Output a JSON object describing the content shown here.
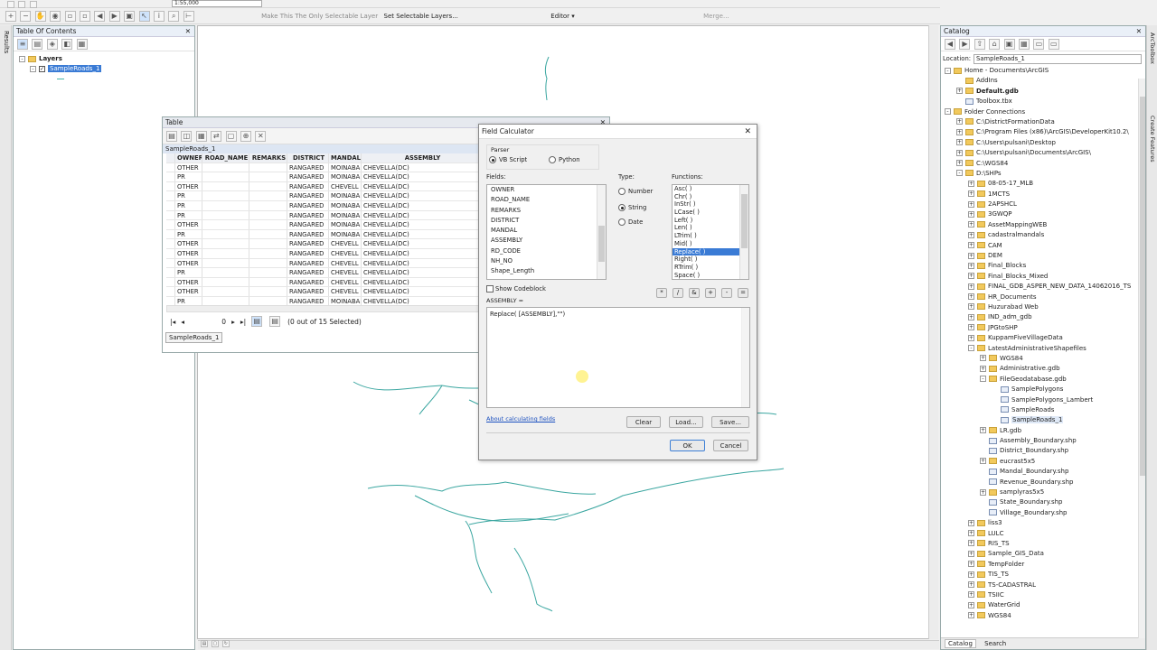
{
  "toolbar": {
    "scale": "1:55,000",
    "selectable_msg": "Make This The Only Selectable Layer",
    "set_selectable": "Set Selectable Layers...",
    "editor": "Editor ▾",
    "merge": "Merge..."
  },
  "toc": {
    "title": "Table Of Contents",
    "side_tab": "Results",
    "layers_label": "Layers",
    "layer_name": "SampleRoads_1"
  },
  "table_win": {
    "title": "Table",
    "tab_name": "SampleRoads_1",
    "columns": [
      "OWNER",
      "ROAD_NAME",
      "REMARKS",
      "DISTRICT",
      "MANDAL",
      "ASSEMBLY"
    ],
    "rows": [
      [
        "OTHER",
        "",
        "",
        "RANGARED",
        "MOINABA",
        "CHEVELLA(DC)"
      ],
      [
        "PR",
        "",
        "",
        "RANGARED",
        "MOINABA",
        "CHEVELLA(DC)"
      ],
      [
        "OTHER",
        "",
        "",
        "RANGARED",
        "CHEVELL",
        "CHEVELLA(DC)"
      ],
      [
        "PR",
        "",
        "",
        "RANGARED",
        "MOINABA",
        "CHEVELLA(DC)"
      ],
      [
        "PR",
        "",
        "",
        "RANGARED",
        "MOINABA",
        "CHEVELLA(DC)"
      ],
      [
        "PR",
        "",
        "",
        "RANGARED",
        "MOINABA",
        "CHEVELLA(DC)"
      ],
      [
        "OTHER",
        "",
        "",
        "RANGARED",
        "MOINABA",
        "CHEVELLA(DC)"
      ],
      [
        "PR",
        "",
        "",
        "RANGARED",
        "MOINABA",
        "CHEVELLA(DC)"
      ],
      [
        "OTHER",
        "",
        "",
        "RANGARED",
        "CHEVELL",
        "CHEVELLA(DC)"
      ],
      [
        "OTHER",
        "",
        "",
        "RANGARED",
        "CHEVELL",
        "CHEVELLA(DC)"
      ],
      [
        "OTHER",
        "",
        "",
        "RANGARED",
        "CHEVELL",
        "CHEVELLA(DC)"
      ],
      [
        "PR",
        "",
        "",
        "RANGARED",
        "CHEVELL",
        "CHEVELLA(DC)"
      ],
      [
        "OTHER",
        "",
        "",
        "RANGARED",
        "CHEVELL",
        "CHEVELLA(DC)"
      ],
      [
        "OTHER",
        "",
        "",
        "RANGARED",
        "CHEVELL",
        "CHEVELLA(DC)"
      ],
      [
        "PR",
        "",
        "",
        "RANGARED",
        "MOINABA",
        "CHEVELLA(DC)"
      ]
    ],
    "record": "0",
    "selected": "(0 out of 15 Selected)",
    "bottom_tab": "SampleRoads_1"
  },
  "calc": {
    "title": "Field Calculator",
    "parser_label": "Parser",
    "vb": "VB Script",
    "python": "Python",
    "fields_label": "Fields:",
    "fields": [
      "OWNER",
      "ROAD_NAME",
      "REMARKS",
      "DISTRICT",
      "MANDAL",
      "ASSEMBLY",
      "RD_CODE",
      "NH_NO",
      "Shape_Length"
    ],
    "type_label": "Type:",
    "type_number": "Number",
    "type_string": "String",
    "type_date": "Date",
    "functions_label": "Functions:",
    "functions": [
      "Asc( )",
      "Chr( )",
      "InStr( )",
      "LCase( )",
      "Left( )",
      "Len( )",
      "LTrim( )",
      "Mid( )",
      "Replace( )",
      "Right( )",
      "RTrim( )",
      "Space( )"
    ],
    "show_codeblock": "Show Codeblock",
    "expr_label": "ASSEMBLY =",
    "expression": "Replace( [ASSEMBLY],\"\")",
    "ops": [
      "*",
      "/",
      "&",
      "+",
      "-",
      "="
    ],
    "about": "About calculating fields",
    "clear": "Clear",
    "load": "Load...",
    "save": "Save...",
    "ok": "OK",
    "cancel": "Cancel"
  },
  "catalog": {
    "title": "Catalog",
    "location_label": "Location:",
    "location": "SampleRoads_1",
    "side_tabs": [
      "ArcToolbox",
      "Create Features"
    ],
    "tree": [
      {
        "t": "Home - Documents\\ArcGIS",
        "d": 0,
        "e": "-"
      },
      {
        "t": "AddIns",
        "d": 1,
        "e": ""
      },
      {
        "t": "Default.gdb",
        "d": 1,
        "e": "+"
      },
      {
        "t": "Toolbox.tbx",
        "d": 1,
        "e": ""
      },
      {
        "t": "Folder Connections",
        "d": 0,
        "e": "-"
      },
      {
        "t": "C:\\DistrictFormationData",
        "d": 1,
        "e": "+"
      },
      {
        "t": "C:\\Program Files (x86)\\ArcGIS\\DeveloperKit10.2\\",
        "d": 1,
        "e": "+"
      },
      {
        "t": "C:\\Users\\pulsani\\Desktop",
        "d": 1,
        "e": "+"
      },
      {
        "t": "C:\\Users\\pulsani\\Documents\\ArcGIS\\",
        "d": 1,
        "e": "+"
      },
      {
        "t": "C:\\WGS84",
        "d": 1,
        "e": "+"
      },
      {
        "t": "D:\\SHPs",
        "d": 1,
        "e": "-"
      },
      {
        "t": "08-05-17_MLB",
        "d": 2,
        "e": "+"
      },
      {
        "t": "1MCTS",
        "d": 2,
        "e": "+"
      },
      {
        "t": "2APSHCL",
        "d": 2,
        "e": "+"
      },
      {
        "t": "3GWQP",
        "d": 2,
        "e": "+"
      },
      {
        "t": "AssetMappingWEB",
        "d": 2,
        "e": "+"
      },
      {
        "t": "cadastralmandals",
        "d": 2,
        "e": "+"
      },
      {
        "t": "CAM",
        "d": 2,
        "e": "+"
      },
      {
        "t": "DEM",
        "d": 2,
        "e": "+"
      },
      {
        "t": "Final_Blocks",
        "d": 2,
        "e": "+"
      },
      {
        "t": "Final_Blocks_Mixed",
        "d": 2,
        "e": "+"
      },
      {
        "t": "FINAL_GDB_ASPER_NEW_DATA_14062016_TS",
        "d": 2,
        "e": "+"
      },
      {
        "t": "HR_Documents",
        "d": 2,
        "e": "+"
      },
      {
        "t": "Huzurabad Web",
        "d": 2,
        "e": "+"
      },
      {
        "t": "IND_adm_gdb",
        "d": 2,
        "e": "+"
      },
      {
        "t": "JPGtoSHP",
        "d": 2,
        "e": "+"
      },
      {
        "t": "KuppamFiveVillageData",
        "d": 2,
        "e": "+"
      },
      {
        "t": "LatestAdministrativeShapefiles",
        "d": 2,
        "e": "-"
      },
      {
        "t": "WGS84",
        "d": 3,
        "e": "+"
      },
      {
        "t": "Administrative.gdb",
        "d": 3,
        "e": "+"
      },
      {
        "t": "FileGeodatabase.gdb",
        "d": 3,
        "e": "-"
      },
      {
        "t": "SamplePolygons",
        "d": 4,
        "e": ""
      },
      {
        "t": "SamplePolygons_Lambert",
        "d": 4,
        "e": ""
      },
      {
        "t": "SampleRoads",
        "d": 4,
        "e": ""
      },
      {
        "t": "SampleRoads_1",
        "d": 4,
        "e": ""
      },
      {
        "t": "LR.gdb",
        "d": 3,
        "e": "+"
      },
      {
        "t": "Assembly_Boundary.shp",
        "d": 3,
        "e": ""
      },
      {
        "t": "District_Boundary.shp",
        "d": 3,
        "e": ""
      },
      {
        "t": "eucrast5x5",
        "d": 3,
        "e": "+"
      },
      {
        "t": "Mandal_Boundary.shp",
        "d": 3,
        "e": ""
      },
      {
        "t": "Revenue_Boundary.shp",
        "d": 3,
        "e": ""
      },
      {
        "t": "samplyras5x5",
        "d": 3,
        "e": "+"
      },
      {
        "t": "State_Boundary.shp",
        "d": 3,
        "e": ""
      },
      {
        "t": "Village_Boundary.shp",
        "d": 3,
        "e": ""
      },
      {
        "t": "liss3",
        "d": 2,
        "e": "+"
      },
      {
        "t": "LULC",
        "d": 2,
        "e": "+"
      },
      {
        "t": "RIS_TS",
        "d": 2,
        "e": "+"
      },
      {
        "t": "Sample_GIS_Data",
        "d": 2,
        "e": "+"
      },
      {
        "t": "TempFolder",
        "d": 2,
        "e": "+"
      },
      {
        "t": "TIS_TS",
        "d": 2,
        "e": "+"
      },
      {
        "t": "TS-CADASTRAL",
        "d": 2,
        "e": "+"
      },
      {
        "t": "TSIIC",
        "d": 2,
        "e": "+"
      },
      {
        "t": "WaterGrid",
        "d": 2,
        "e": "+"
      },
      {
        "t": "WGS84",
        "d": 2,
        "e": "+"
      }
    ],
    "tab_catalog": "Catalog",
    "tab_search": "Search"
  }
}
